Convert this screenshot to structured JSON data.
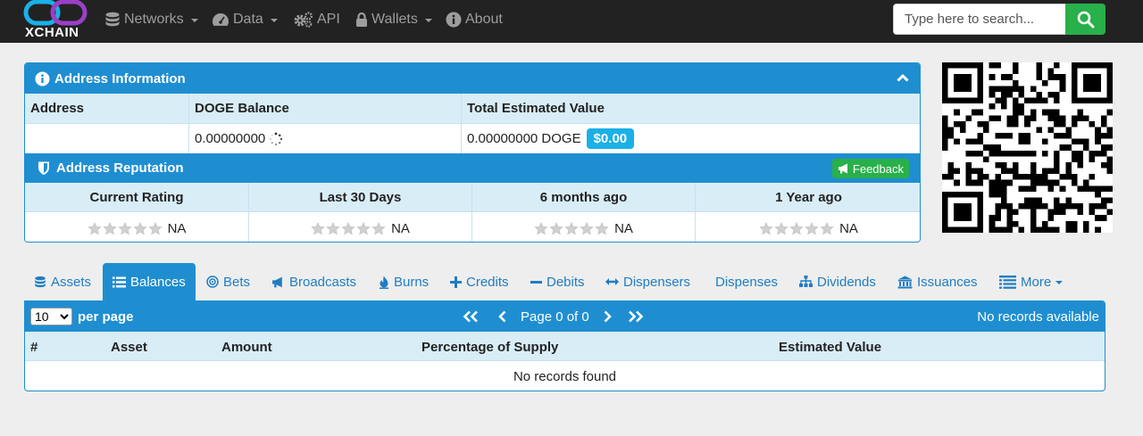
{
  "brand": {
    "name": "XCHAIN"
  },
  "nav": [
    {
      "label": "Networks",
      "icon": "database-icon",
      "dropdown": true
    },
    {
      "label": "Data",
      "icon": "dashboard-icon",
      "dropdown": true
    },
    {
      "label": "API",
      "icon": "gears-icon",
      "dropdown": false
    },
    {
      "label": "Wallets",
      "icon": "lock-icon",
      "dropdown": true
    },
    {
      "label": "About",
      "icon": "info-icon",
      "dropdown": false
    }
  ],
  "search": {
    "placeholder": "Type here to search..."
  },
  "address_info": {
    "title": "Address Information",
    "headers": {
      "address": "Address",
      "balance": "DOGE Balance",
      "total": "Total Estimated Value"
    },
    "row": {
      "address": "",
      "balance": "0.00000000",
      "total": "0.00000000 DOGE",
      "usd": "$0.00"
    }
  },
  "reputation": {
    "title": "Address Reputation",
    "feedback_label": "Feedback",
    "columns": [
      {
        "header": "Current Rating",
        "value": "NA",
        "stars": 0
      },
      {
        "header": "Last 30 Days",
        "value": "NA",
        "stars": 0
      },
      {
        "header": "6 months ago",
        "value": "NA",
        "stars": 0
      },
      {
        "header": "1 Year ago",
        "value": "NA",
        "stars": 0
      }
    ]
  },
  "tabs": [
    {
      "label": "Assets",
      "icon": "database-icon",
      "active": false
    },
    {
      "label": "Balances",
      "icon": "list-icon",
      "active": true
    },
    {
      "label": "Bets",
      "icon": "target-icon",
      "active": false
    },
    {
      "label": "Broadcasts",
      "icon": "bullhorn-icon",
      "active": false
    },
    {
      "label": "Burns",
      "icon": "fire-icon",
      "active": false
    },
    {
      "label": "Credits",
      "icon": "plus-icon",
      "active": false
    },
    {
      "label": "Debits",
      "icon": "minus-icon",
      "active": false
    },
    {
      "label": "Dispensers",
      "icon": "arrows-h-icon",
      "active": false
    },
    {
      "label": "Dispenses",
      "icon": "",
      "active": false
    },
    {
      "label": "Dividends",
      "icon": "sitemap-icon",
      "active": false
    },
    {
      "label": "Issuances",
      "icon": "bank-icon",
      "active": false
    },
    {
      "label": "More",
      "icon": "list-alt-icon",
      "active": false,
      "dropdown": true
    }
  ],
  "balances": {
    "per_page_value": "10",
    "per_page_label": "per page",
    "page_text": "Page 0 of 0",
    "status": "No records available",
    "columns": [
      "#",
      "Asset",
      "Amount",
      "Percentage of Supply",
      "Estimated Value"
    ],
    "empty": "No records found"
  },
  "colors": {
    "primary": "#1f8ed1",
    "header_bg": "#d9edf7",
    "success": "#28b04a",
    "navbar": "#222222",
    "badge": "#1ab0e8"
  }
}
